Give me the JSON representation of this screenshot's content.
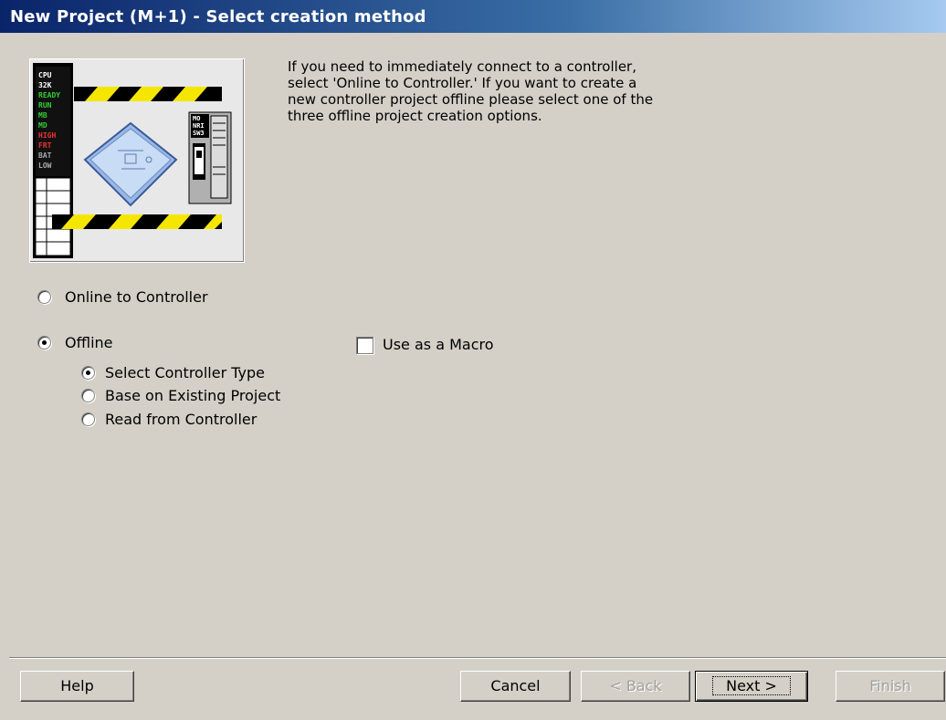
{
  "window": {
    "title": "New Project (M+1) - Select creation method"
  },
  "intro_text": "If you need to immediately connect to a controller,\nselect 'Online to Controller.'  If you want to create a\nnew controller project offline please select one of the\nthree offline project creation options.",
  "illustration": {
    "plc_labels": [
      "CPU",
      "32K",
      "READY",
      "RUN",
      "MB",
      "MD",
      "HIGH",
      "FRT",
      "BAT",
      "LOW"
    ],
    "module_labels": [
      "MO",
      "NRI",
      "SW3"
    ]
  },
  "options": {
    "online": {
      "label": "Online to Controller",
      "selected": false
    },
    "offline": {
      "label": "Offline",
      "selected": true
    },
    "offline_sub": [
      {
        "label": "Select Controller Type",
        "selected": true
      },
      {
        "label": "Base on Existing Project",
        "selected": false
      },
      {
        "label": "Read from Controller",
        "selected": false
      }
    ],
    "use_as_macro": {
      "label": "Use as a Macro",
      "checked": false
    }
  },
  "buttons": {
    "help": "Help",
    "cancel": "Cancel",
    "back": "< Back",
    "next": "Next >",
    "finish": "Finish"
  }
}
